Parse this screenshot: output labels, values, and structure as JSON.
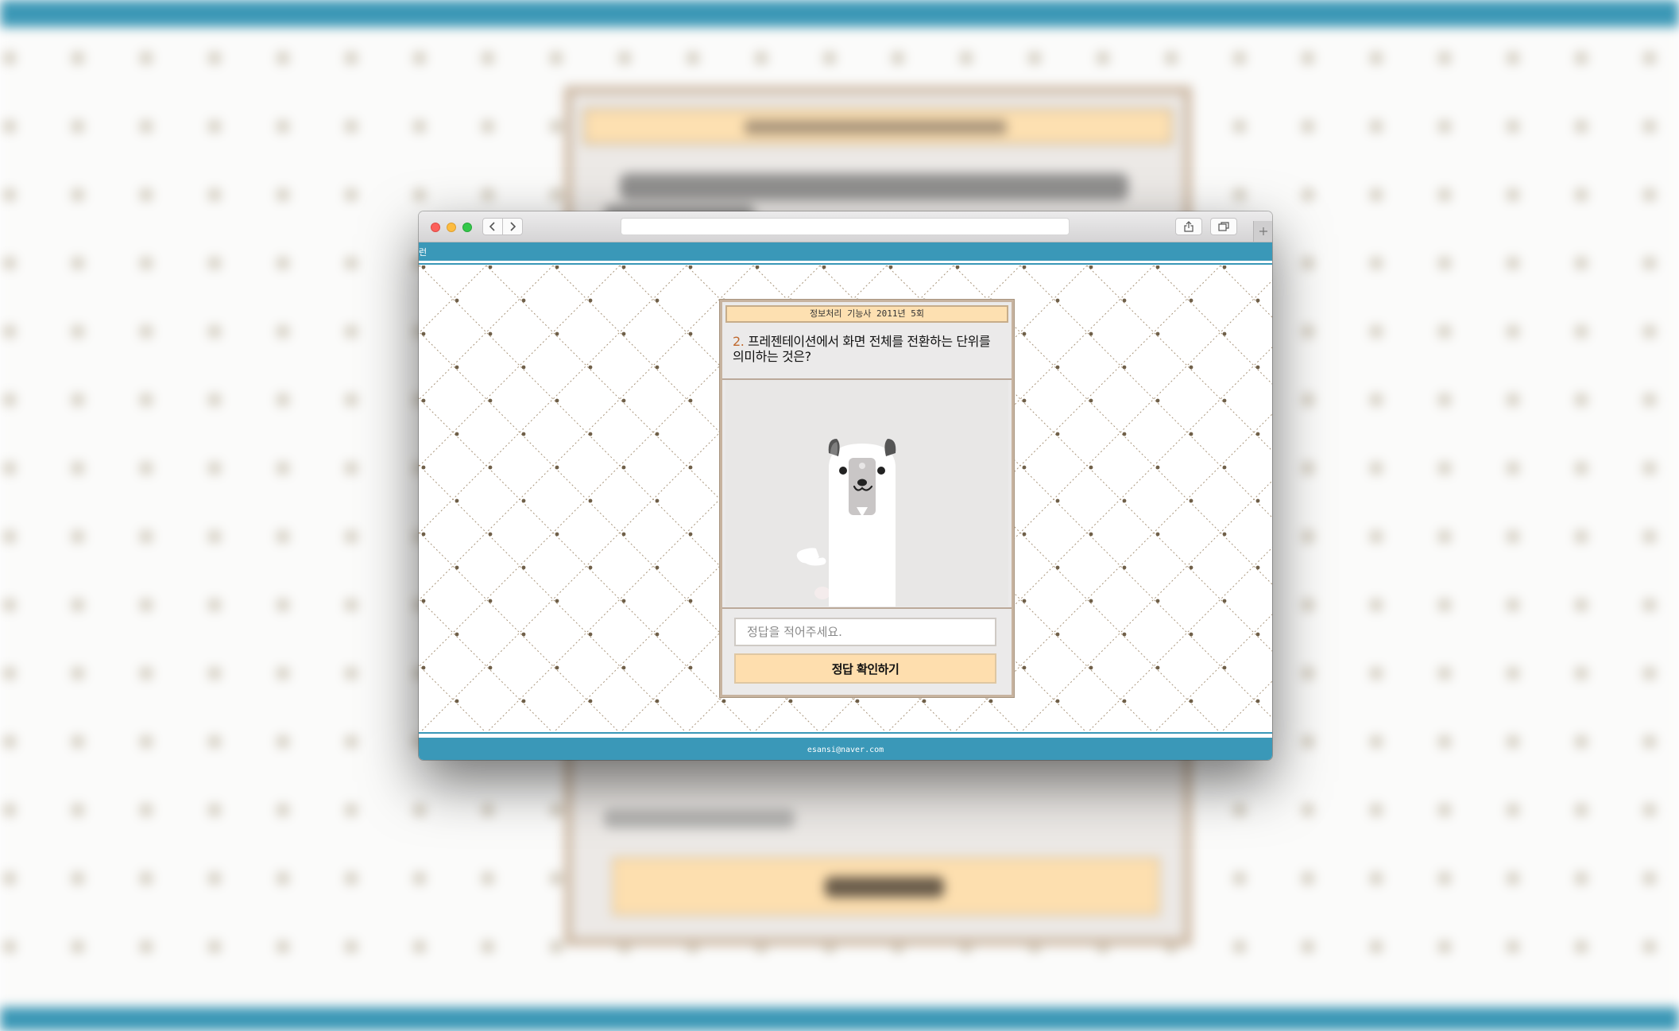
{
  "site": {
    "header_title": "런",
    "footer_email": "esansi@naver.com"
  },
  "quiz": {
    "header": "정보처리 기능사 2011년 5회",
    "question_number": "2.",
    "question_text": " 프레젠테이션에서 화면 전체를 전환하는 단위를 의미하는 것은?",
    "answer_placeholder": "정답을 적어주세요.",
    "answer_value": "",
    "submit_label": "정답 확인하기"
  },
  "icons": {
    "back": "chevron-left-icon",
    "forward": "chevron-right-icon",
    "share": "share-icon",
    "tabs": "tabs-overview-icon",
    "new_tab": "plus-icon",
    "illustration": "white-dog-illustration"
  },
  "colors": {
    "accent_blue": "#3a98b8",
    "card_header_bg": "#fde0b1",
    "submit_bg": "#fedeae",
    "card_border": "#c7b39f",
    "question_number": "#c0692e"
  }
}
